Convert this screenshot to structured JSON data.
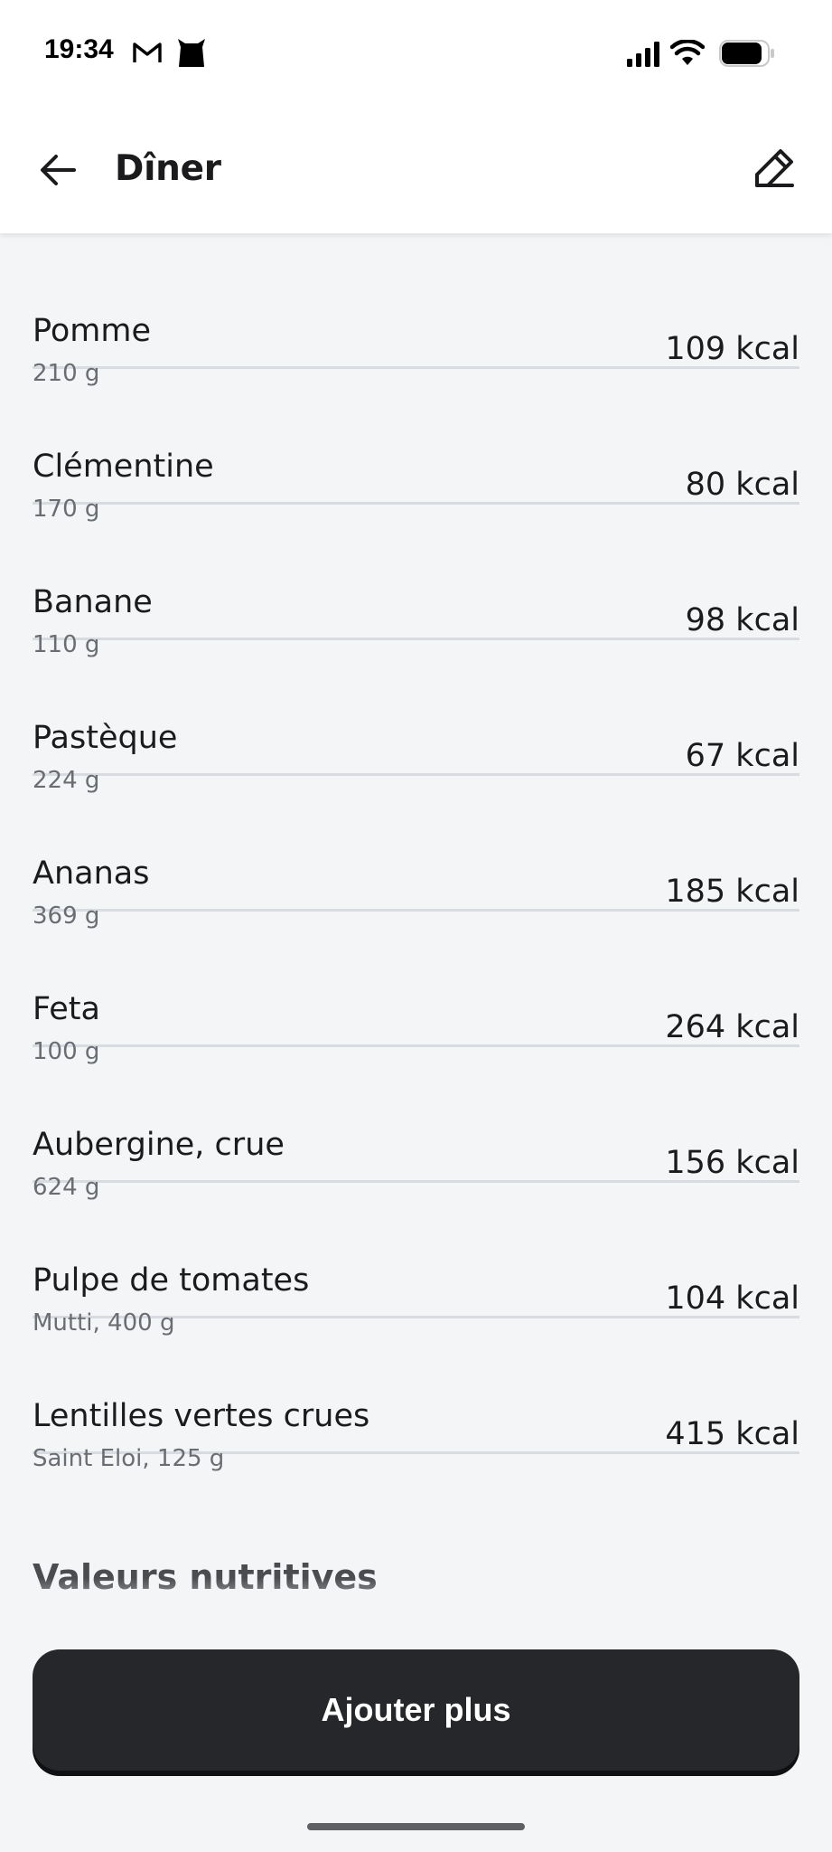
{
  "status_bar": {
    "time": "19:34",
    "left_icons": [
      "gmail-icon",
      "app-cat-icon"
    ],
    "right_icons": [
      "signal-icon",
      "wifi-icon",
      "battery-icon"
    ]
  },
  "header": {
    "title": "Dîner",
    "back_icon": "arrow-left-icon",
    "edit_icon": "pencil-icon"
  },
  "foods": [
    {
      "name": "Pomme",
      "detail": "210 g",
      "kcal": "109 kcal"
    },
    {
      "name": "Clémentine",
      "detail": "170 g",
      "kcal": "80 kcal"
    },
    {
      "name": "Banane",
      "detail": "110 g",
      "kcal": "98 kcal"
    },
    {
      "name": "Pastèque",
      "detail": "224 g",
      "kcal": "67 kcal"
    },
    {
      "name": "Ananas",
      "detail": "369 g",
      "kcal": "185 kcal"
    },
    {
      "name": "Feta",
      "detail": "100 g",
      "kcal": "264 kcal"
    },
    {
      "name": "Aubergine, crue",
      "detail": "624 g",
      "kcal": "156 kcal"
    },
    {
      "name": "Pulpe de tomates",
      "detail": "Mutti, 400 g",
      "kcal": "104 kcal"
    },
    {
      "name": "Lentilles vertes crues",
      "detail": "Saint Eloi, 125 g",
      "kcal": "415 kcal"
    }
  ],
  "nutrition_section": {
    "title": "Valeurs nutritives"
  },
  "add_button": {
    "label": "Ajouter plus"
  },
  "colors": {
    "background": "#f4f5f7",
    "header": "#ffffff",
    "primary_button": "#26272a",
    "divider": "#d8dbe0",
    "secondary_text": "#6a6d73"
  }
}
